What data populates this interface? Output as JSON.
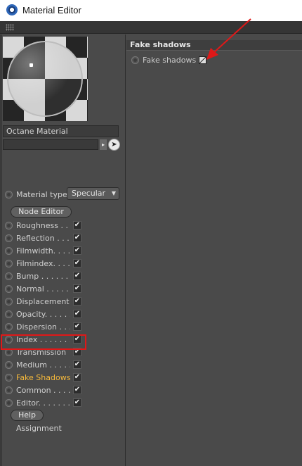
{
  "window": {
    "title": "Material Editor",
    "icon": "cinema4d-icon"
  },
  "material": {
    "name": "Octane Material",
    "type_label": "Material type",
    "type_value": "Specular"
  },
  "buttons": {
    "node_editor": "Node Editor",
    "help": "Help"
  },
  "channels": [
    {
      "label": "Roughness . . .",
      "checked": true
    },
    {
      "label": "Reflection . . .",
      "checked": true
    },
    {
      "label": "Filmwidth. . . .",
      "checked": true
    },
    {
      "label": "Filmindex. . . .",
      "checked": true
    },
    {
      "label": "Bump . . . . . . .",
      "checked": true
    },
    {
      "label": "Normal . . . . . .",
      "checked": true
    },
    {
      "label": "Displacement",
      "checked": true
    },
    {
      "label": "Opacity. . . . . .",
      "checked": true
    },
    {
      "label": "Dispersion . . .",
      "checked": true
    },
    {
      "label": "Index . . . . . . .",
      "checked": true
    },
    {
      "label": "Transmission",
      "checked": true
    },
    {
      "label": "Medium . . . . .",
      "checked": true
    },
    {
      "label": "Fake Shadows",
      "checked": true,
      "active": true
    },
    {
      "label": "Common . . . .",
      "checked": true
    },
    {
      "label": "Editor. . . . . . .",
      "checked": true
    }
  ],
  "assignment_label": "Assignment",
  "right": {
    "section_title": "Fake shadows",
    "param_label": "Fake shadows",
    "param_checked": true
  },
  "colors": {
    "highlight": "#e01818",
    "active_text": "#f6b93b",
    "annotation_arrow": "#e01818"
  }
}
